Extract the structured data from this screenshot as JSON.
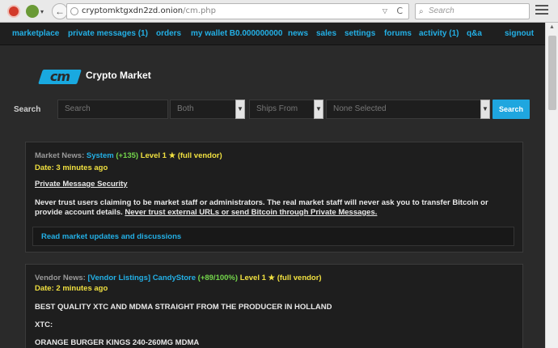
{
  "browser": {
    "url_host": "cryptomktgxdn2zd.onion",
    "url_path": "/cm.php",
    "search_placeholder": "Search",
    "back_glyph": "←",
    "dropdown_glyph": "▽",
    "reload_glyph": "C",
    "search_glyph": "⌕",
    "icons": [
      "tor-button-icon",
      "onion-icon",
      "back-arrow-icon",
      "ssl-info-icon",
      "reload-icon",
      "search-icon",
      "hamburger-menu-icon"
    ]
  },
  "nav": {
    "items": [
      "marketplace",
      "private messages (1)",
      "orders",
      "my wallet B0.000000000",
      "news",
      "sales",
      "settings",
      "forums",
      "activity (1)",
      "q&a",
      "signout"
    ]
  },
  "brand": {
    "logo_text": "cm",
    "name": "Crypto Market"
  },
  "search": {
    "label": "Search",
    "input_placeholder": "Search",
    "type_selected": "Both",
    "ships_from_selected": "Ships From",
    "ships_to_selected": "None Selected",
    "button": "Search"
  },
  "news1": {
    "prefix": "Market News:",
    "author": "System",
    "rating": "(+135)",
    "level": "Level 1 ★",
    "vendor": "(full vendor)",
    "date": "Date: 3 minutes ago",
    "subject": "Private Message Security",
    "body1": "Never trust users claiming to be market staff or administrators. The real market staff will never ask you to transfer Bitcoin or",
    "body2a": "provide account details.",
    "body2b": "Never trust external URLs or send Bitcoin through Private Messages.",
    "link": "Read market updates and discussions"
  },
  "news2": {
    "prefix": "Vendor News:",
    "author": "[Vendor Listings] CandyStore",
    "rating": "(+89/100%)",
    "level": "Level 1 ★",
    "vendor": "(full vendor)",
    "date": "Date: 2 minutes ago",
    "line1": "BEST QUALITY XTC AND MDMA STRAIGHT FROM THE PRODUCER IN HOLLAND",
    "line2": "XTC:",
    "line3": "ORANGE BURGER KINGS 240-260MG MDMA"
  },
  "colors": {
    "accent": "#23b0e6",
    "background": "#2a2a2a",
    "panel": "#1e1e1e",
    "rating_green": "#74d64b",
    "level_yellow": "#f0e040"
  }
}
